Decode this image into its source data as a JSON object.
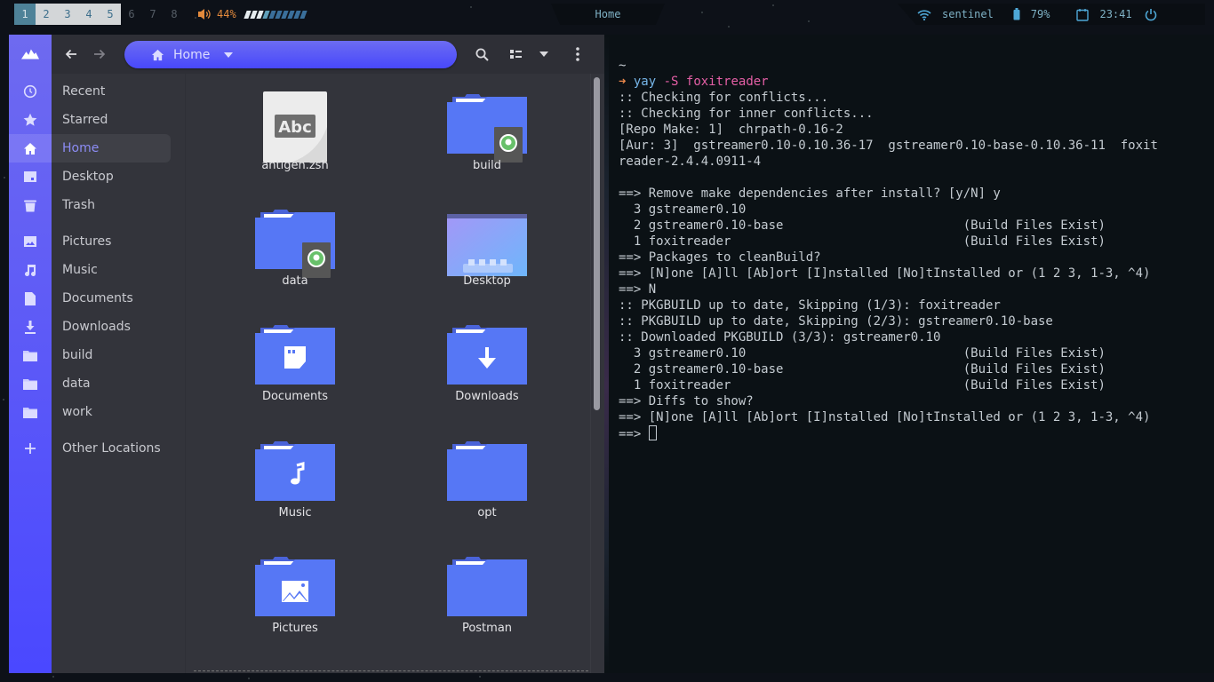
{
  "topbar": {
    "workspaces": [
      "1",
      "2",
      "3",
      "4",
      "5",
      "6",
      "7",
      "8"
    ],
    "active_workspace": "1",
    "occupied_workspaces": [
      "2",
      "3",
      "4",
      "5"
    ],
    "volume": {
      "icon": "speaker-icon",
      "label": "44%",
      "percent": 44
    },
    "window_title": "Home",
    "network": {
      "icon": "wifi-icon",
      "label": "sentinel"
    },
    "battery": {
      "icon": "battery-icon",
      "label": "79%"
    },
    "clock": {
      "icon": "calendar-icon",
      "label": "23:41"
    },
    "power": {
      "icon": "power-icon"
    }
  },
  "colors": {
    "accent": "#5858f5",
    "rail_top": "#6e6af0",
    "rail_bottom": "#4a48ff",
    "fm_bg": "#33343b",
    "terminal_bg": "#0b1115",
    "folder": "#5677f5",
    "prompt_arrow": "#ef8a4b",
    "command": "#e45fa6"
  },
  "file_manager": {
    "nav": {
      "back_icon": "arrow-left-icon",
      "forward_icon": "arrow-right-icon"
    },
    "path": {
      "icon": "home-icon",
      "label": "Home"
    },
    "toolbar": {
      "search_icon": "search-icon",
      "view_icon": "list-view-icon",
      "view_menu_icon": "chevron-down-icon",
      "menu_icon": "kebab-menu-icon"
    },
    "sidebar": [
      {
        "label": "Recent",
        "icon": "clock-icon"
      },
      {
        "label": "Starred",
        "icon": "star-icon"
      },
      {
        "label": "Home",
        "icon": "home-icon",
        "active": true
      },
      {
        "label": "Desktop",
        "icon": "desktop-icon"
      },
      {
        "label": "Trash",
        "icon": "trash-icon"
      },
      {
        "label": "Pictures",
        "icon": "image-icon"
      },
      {
        "label": "Music",
        "icon": "music-icon"
      },
      {
        "label": "Documents",
        "icon": "document-icon"
      },
      {
        "label": "Downloads",
        "icon": "download-icon"
      },
      {
        "label": "build",
        "icon": "folder-icon"
      },
      {
        "label": "data",
        "icon": "folder-icon"
      },
      {
        "label": "work",
        "icon": "folder-icon"
      },
      {
        "label": "Other Locations",
        "icon": "plus-icon"
      }
    ],
    "files": [
      {
        "name": "antigen.zsh",
        "type": "text-file"
      },
      {
        "name": "build",
        "type": "folder-shared"
      },
      {
        "name": "data",
        "type": "folder-shared"
      },
      {
        "name": "Desktop",
        "type": "desktop-folder"
      },
      {
        "name": "Documents",
        "type": "documents-folder"
      },
      {
        "name": "Downloads",
        "type": "downloads-folder"
      },
      {
        "name": "Music",
        "type": "music-folder"
      },
      {
        "name": "opt",
        "type": "folder"
      },
      {
        "name": "Pictures",
        "type": "pictures-folder"
      },
      {
        "name": "Postman",
        "type": "folder"
      }
    ],
    "file_icon_text": "Abc"
  },
  "terminal": {
    "cwd": "~",
    "prompt_arrow": "➜",
    "command_name": "yay",
    "command_args": " -S foxitreader",
    "lines": [
      ":: Checking for conflicts...",
      ":: Checking for inner conflicts...",
      "[Repo Make: 1]  chrpath-0.16-2",
      "[Aur: 3]  gstreamer0.10-0.10.36-17  gstreamer0.10-base-0.10.36-11  foxit",
      "reader-2.4.4.0911-4",
      "",
      "==> Remove make dependencies after install? [y/N] y",
      "  3 gstreamer0.10",
      "  2 gstreamer0.10-base                        (Build Files Exist)",
      "  1 foxitreader                               (Build Files Exist)",
      "==> Packages to cleanBuild?",
      "==> [N]one [A]ll [Ab]ort [I]nstalled [No]tInstalled or (1 2 3, 1-3, ^4)",
      "==> N",
      ":: PKGBUILD up to date, Skipping (1/3): foxitreader",
      ":: PKGBUILD up to date, Skipping (2/3): gstreamer0.10-base",
      ":: Downloaded PKGBUILD (3/3): gstreamer0.10",
      "  3 gstreamer0.10                             (Build Files Exist)",
      "  2 gstreamer0.10-base                        (Build Files Exist)",
      "  1 foxitreader                               (Build Files Exist)",
      "==> Diffs to show?",
      "==> [N]one [A]ll [Ab]ort [I]nstalled [No]tInstalled or (1 2 3, 1-3, ^4)"
    ],
    "input_prompt": "==> ",
    "input_value": ""
  }
}
